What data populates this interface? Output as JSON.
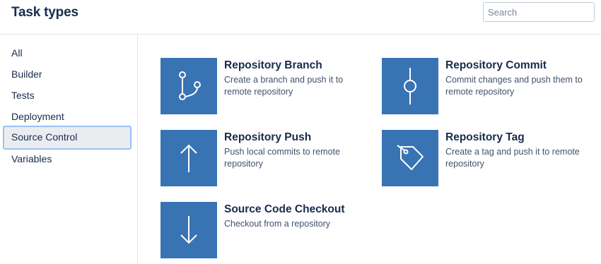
{
  "header": {
    "title": "Task types",
    "search_placeholder": "Search"
  },
  "sidebar": {
    "items": [
      {
        "label": "All"
      },
      {
        "label": "Builder"
      },
      {
        "label": "Tests"
      },
      {
        "label": "Deployment"
      },
      {
        "label": "Source Control",
        "selected": true
      },
      {
        "label": "Variables"
      }
    ]
  },
  "tasks": [
    {
      "title": "Repository Branch",
      "description": "Create a branch and push it to remote repository",
      "icon": "branch-icon"
    },
    {
      "title": "Repository Commit",
      "description": "Commit changes and push them to remote repository",
      "icon": "commit-icon"
    },
    {
      "title": "Repository Push",
      "description": "Push local commits to remote repository",
      "icon": "arrow-up-icon"
    },
    {
      "title": "Repository Tag",
      "description": "Create a tag and push it to remote repository",
      "icon": "tag-icon"
    },
    {
      "title": "Source Code Checkout",
      "description": "Checkout from a repository",
      "icon": "arrow-down-icon"
    }
  ],
  "colors": {
    "tile": "#3874b4",
    "selected_border": "#9bc1f5",
    "selected_bg": "#ebecf0",
    "text": "#172b4d",
    "muted_text": "#42526e"
  }
}
